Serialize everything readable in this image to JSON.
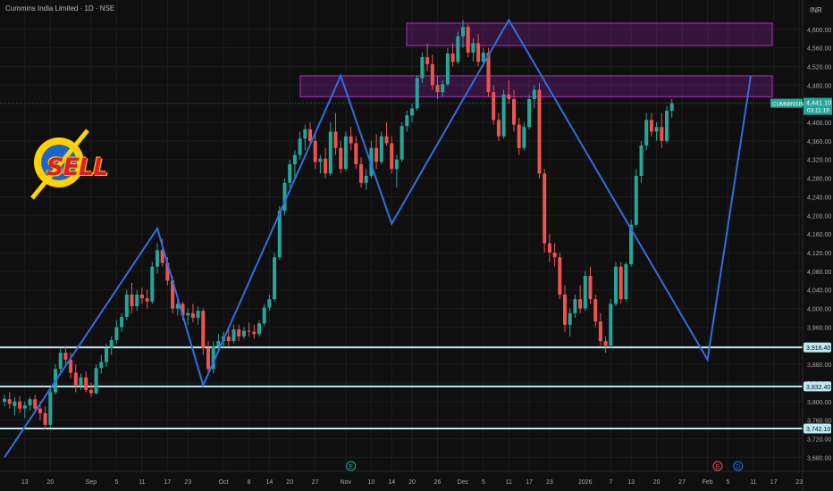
{
  "header": {
    "title": "Cummins India Limited · 1D · NSE"
  },
  "colors": {
    "up": "#26a69a",
    "down": "#ef5350",
    "zigzag": "#2f6fe0",
    "zone": "#9c27b0",
    "level": "#bfe9f5"
  },
  "overlay": {
    "sell_label": "SELL"
  },
  "chart_data": {
    "type": "candlestick",
    "currency": "INR",
    "ylim": [
      3660,
      4640
    ],
    "y_ticks": [
      "3,680.00",
      "3,720.00",
      "3,760.00",
      "3,800.00",
      "3,840.00",
      "3,880.00",
      "3,920.00",
      "3,960.00",
      "4,000.00",
      "4,040.00",
      "4,080.00",
      "4,120.00",
      "4,160.00",
      "4,200.00",
      "4,240.00",
      "4,280.00",
      "4,320.00",
      "4,360.00",
      "4,400.00",
      "4,440.00",
      "4,480.00",
      "4,520.00",
      "4,560.00",
      "4,600.00"
    ],
    "x_ticks": [
      {
        "label": "13",
        "i": 4
      },
      {
        "label": "20",
        "i": 9
      },
      {
        "label": "Sep",
        "i": 17
      },
      {
        "label": "5",
        "i": 22
      },
      {
        "label": "11",
        "i": 27
      },
      {
        "label": "17",
        "i": 32
      },
      {
        "label": "23",
        "i": 36
      },
      {
        "label": "Oct",
        "i": 43
      },
      {
        "label": "8",
        "i": 48
      },
      {
        "label": "14",
        "i": 52
      },
      {
        "label": "20",
        "i": 56
      },
      {
        "label": "27",
        "i": 61
      },
      {
        "label": "Nov",
        "i": 67
      },
      {
        "label": "10",
        "i": 72
      },
      {
        "label": "14",
        "i": 76
      },
      {
        "label": "20",
        "i": 80
      },
      {
        "label": "26",
        "i": 85
      },
      {
        "label": "Dec",
        "i": 90
      },
      {
        "label": "5",
        "i": 94
      },
      {
        "label": "11",
        "i": 99
      },
      {
        "label": "17",
        "i": 103
      },
      {
        "label": "23",
        "i": 107
      },
      {
        "label": "2026",
        "i": 114
      },
      {
        "label": "7",
        "i": 119
      },
      {
        "label": "13",
        "i": 123
      },
      {
        "label": "20",
        "i": 128
      },
      {
        "label": "27",
        "i": 133
      },
      {
        "label": "Feb",
        "i": 138
      },
      {
        "label": "5",
        "i": 142
      },
      {
        "label": "11",
        "i": 147
      },
      {
        "label": "17",
        "i": 151
      },
      {
        "label": "23",
        "i": 156
      }
    ],
    "candles": [
      [
        3800,
        3815,
        3790,
        3806
      ],
      [
        3805,
        3820,
        3785,
        3795
      ],
      [
        3790,
        3810,
        3770,
        3800
      ],
      [
        3800,
        3812,
        3775,
        3785
      ],
      [
        3785,
        3800,
        3765,
        3792
      ],
      [
        3792,
        3810,
        3780,
        3805
      ],
      [
        3805,
        3815,
        3775,
        3785
      ],
      [
        3785,
        3800,
        3760,
        3775
      ],
      [
        3775,
        3790,
        3740,
        3750
      ],
      [
        3750,
        3830,
        3745,
        3820
      ],
      [
        3820,
        3880,
        3815,
        3870
      ],
      [
        3870,
        3915,
        3860,
        3905
      ],
      [
        3905,
        3920,
        3880,
        3890
      ],
      [
        3890,
        3905,
        3850,
        3862
      ],
      [
        3862,
        3880,
        3820,
        3835
      ],
      [
        3835,
        3860,
        3825,
        3852
      ],
      [
        3852,
        3865,
        3820,
        3825
      ],
      [
        3825,
        3840,
        3810,
        3818
      ],
      [
        3818,
        3880,
        3815,
        3872
      ],
      [
        3872,
        3900,
        3860,
        3885
      ],
      [
        3885,
        3925,
        3875,
        3915
      ],
      [
        3915,
        3940,
        3900,
        3932
      ],
      [
        3932,
        3975,
        3925,
        3960
      ],
      [
        3960,
        3990,
        3950,
        3982
      ],
      [
        3982,
        4040,
        3975,
        4030
      ],
      [
        4030,
        4055,
        3990,
        4005
      ],
      [
        4005,
        4040,
        3995,
        4030
      ],
      [
        4030,
        4045,
        4010,
        4022
      ],
      [
        4022,
        4040,
        4000,
        4015
      ],
      [
        4015,
        4100,
        4010,
        4090
      ],
      [
        4090,
        4140,
        4075,
        4125
      ],
      [
        4125,
        4150,
        4090,
        4098
      ],
      [
        4098,
        4110,
        4050,
        4060
      ],
      [
        4060,
        4070,
        3990,
        4000
      ],
      [
        4000,
        4020,
        3985,
        4010
      ],
      [
        4010,
        4015,
        3975,
        3985
      ],
      [
        3985,
        4000,
        3965,
        3990
      ],
      [
        3990,
        4010,
        3970,
        3980
      ],
      [
        3980,
        4005,
        3965,
        3995
      ],
      [
        3995,
        4000,
        3900,
        3915
      ],
      [
        3915,
        3930,
        3860,
        3870
      ],
      [
        3870,
        3930,
        3860,
        3918
      ],
      [
        3918,
        3945,
        3905,
        3930
      ],
      [
        3930,
        3950,
        3915,
        3940
      ],
      [
        3940,
        3960,
        3920,
        3930
      ],
      [
        3930,
        3965,
        3925,
        3955
      ],
      [
        3955,
        3965,
        3930,
        3940
      ],
      [
        3940,
        3960,
        3935,
        3952
      ],
      [
        3952,
        3970,
        3940,
        3950
      ],
      [
        3950,
        3965,
        3935,
        3945
      ],
      [
        3945,
        3975,
        3940,
        3968
      ],
      [
        3968,
        4010,
        3962,
        4002
      ],
      [
        4002,
        4030,
        3995,
        4020
      ],
      [
        4020,
        4120,
        4015,
        4110
      ],
      [
        4110,
        4220,
        4105,
        4210
      ],
      [
        4210,
        4280,
        4200,
        4270
      ],
      [
        4270,
        4320,
        4260,
        4310
      ],
      [
        4310,
        4340,
        4280,
        4330
      ],
      [
        4330,
        4380,
        4320,
        4365
      ],
      [
        4365,
        4395,
        4340,
        4385
      ],
      [
        4385,
        4400,
        4350,
        4360
      ],
      [
        4360,
        4380,
        4300,
        4315
      ],
      [
        4315,
        4330,
        4290,
        4322
      ],
      [
        4322,
        4345,
        4280,
        4290
      ],
      [
        4290,
        4400,
        4285,
        4380
      ],
      [
        4380,
        4420,
        4330,
        4345
      ],
      [
        4345,
        4360,
        4290,
        4300
      ],
      [
        4300,
        4380,
        4295,
        4370
      ],
      [
        4370,
        4390,
        4340,
        4355
      ],
      [
        4355,
        4370,
        4300,
        4310
      ],
      [
        4310,
        4325,
        4260,
        4270
      ],
      [
        4270,
        4300,
        4255,
        4285
      ],
      [
        4285,
        4360,
        4280,
        4345
      ],
      [
        4345,
        4375,
        4300,
        4315
      ],
      [
        4315,
        4380,
        4310,
        4370
      ],
      [
        4370,
        4400,
        4350,
        4355
      ],
      [
        4355,
        4370,
        4290,
        4300
      ],
      [
        4300,
        4330,
        4260,
        4320
      ],
      [
        4320,
        4400,
        4315,
        4392
      ],
      [
        4392,
        4425,
        4380,
        4415
      ],
      [
        4415,
        4440,
        4400,
        4430
      ],
      [
        4430,
        4500,
        4425,
        4495
      ],
      [
        4495,
        4550,
        4485,
        4540
      ],
      [
        4540,
        4570,
        4510,
        4525
      ],
      [
        4525,
        4545,
        4470,
        4480
      ],
      [
        4480,
        4500,
        4450,
        4465
      ],
      [
        4465,
        4490,
        4455,
        4482
      ],
      [
        4482,
        4560,
        4478,
        4548
      ],
      [
        4548,
        4570,
        4520,
        4530
      ],
      [
        4530,
        4595,
        4525,
        4585
      ],
      [
        4585,
        4620,
        4560,
        4605
      ],
      [
        4605,
        4610,
        4540,
        4550
      ],
      [
        4550,
        4580,
        4530,
        4570
      ],
      [
        4570,
        4590,
        4520,
        4530
      ],
      [
        4530,
        4560,
        4520,
        4550
      ],
      [
        4550,
        4560,
        4455,
        4465
      ],
      [
        4465,
        4480,
        4395,
        4405
      ],
      [
        4405,
        4420,
        4360,
        4370
      ],
      [
        4370,
        4470,
        4365,
        4460
      ],
      [
        4460,
        4490,
        4440,
        4450
      ],
      [
        4450,
        4470,
        4380,
        4395
      ],
      [
        4395,
        4410,
        4330,
        4345
      ],
      [
        4345,
        4400,
        4340,
        4390
      ],
      [
        4390,
        4460,
        4385,
        4450
      ],
      [
        4450,
        4480,
        4430,
        4470
      ],
      [
        4470,
        4485,
        4280,
        4290
      ],
      [
        4290,
        4300,
        4120,
        4140
      ],
      [
        4140,
        4160,
        4100,
        4120
      ],
      [
        4120,
        4140,
        4090,
        4110
      ],
      [
        4110,
        4120,
        4020,
        4030
      ],
      [
        4030,
        4050,
        3950,
        3965
      ],
      [
        3965,
        4000,
        3940,
        3990
      ],
      [
        3990,
        4030,
        3980,
        4020
      ],
      [
        4020,
        4050,
        3990,
        4000
      ],
      [
        4000,
        4080,
        3995,
        4070
      ],
      [
        4070,
        4090,
        4010,
        4020
      ],
      [
        4020,
        4030,
        3960,
        3972
      ],
      [
        3972,
        3990,
        3920,
        3930
      ],
      [
        3930,
        3940,
        3905,
        3920
      ],
      [
        3920,
        4020,
        3915,
        4010
      ],
      [
        4010,
        4100,
        4005,
        4090
      ],
      [
        4090,
        4100,
        4010,
        4020
      ],
      [
        4020,
        4100,
        4015,
        4095
      ],
      [
        4095,
        4190,
        4090,
        4180
      ],
      [
        4180,
        4300,
        4175,
        4285
      ],
      [
        4285,
        4360,
        4270,
        4350
      ],
      [
        4350,
        4420,
        4340,
        4405
      ],
      [
        4405,
        4420,
        4370,
        4380
      ],
      [
        4380,
        4400,
        4360,
        4390
      ],
      [
        4390,
        4420,
        4345,
        4360
      ],
      [
        4360,
        4435,
        4355,
        4425
      ],
      [
        4425,
        4450,
        4410,
        4441
      ]
    ],
    "zigzag": [
      [
        0,
        3680
      ],
      [
        30,
        4172
      ],
      [
        39,
        3835
      ],
      [
        66,
        4500
      ],
      [
        76,
        4182
      ],
      [
        99,
        4620
      ],
      [
        138,
        3890
      ],
      [
        146,
        4500
      ]
    ],
    "zigzag_last_x": 146.5,
    "resistance_zones": [
      {
        "from": 4565,
        "to": 4613
      },
      {
        "from": 4455,
        "to": 4500
      }
    ],
    "support_levels": [
      {
        "value": 3916.4,
        "label": "3,916.40"
      },
      {
        "value": 3832.4,
        "label": "3,832.40"
      },
      {
        "value": 3742.1,
        "label": "3,742.10"
      }
    ],
    "last_price": {
      "symbol": "CUMMINSIND",
      "value": "4,441.10",
      "countdown": "03:11:19"
    },
    "event_markers": [
      {
        "label": "E",
        "i": 68,
        "color": "#26a69a"
      },
      {
        "label": "E",
        "i": 140,
        "color": "#ef5350"
      },
      {
        "label": "D",
        "i": 144,
        "color": "#2f6fe0"
      }
    ]
  }
}
